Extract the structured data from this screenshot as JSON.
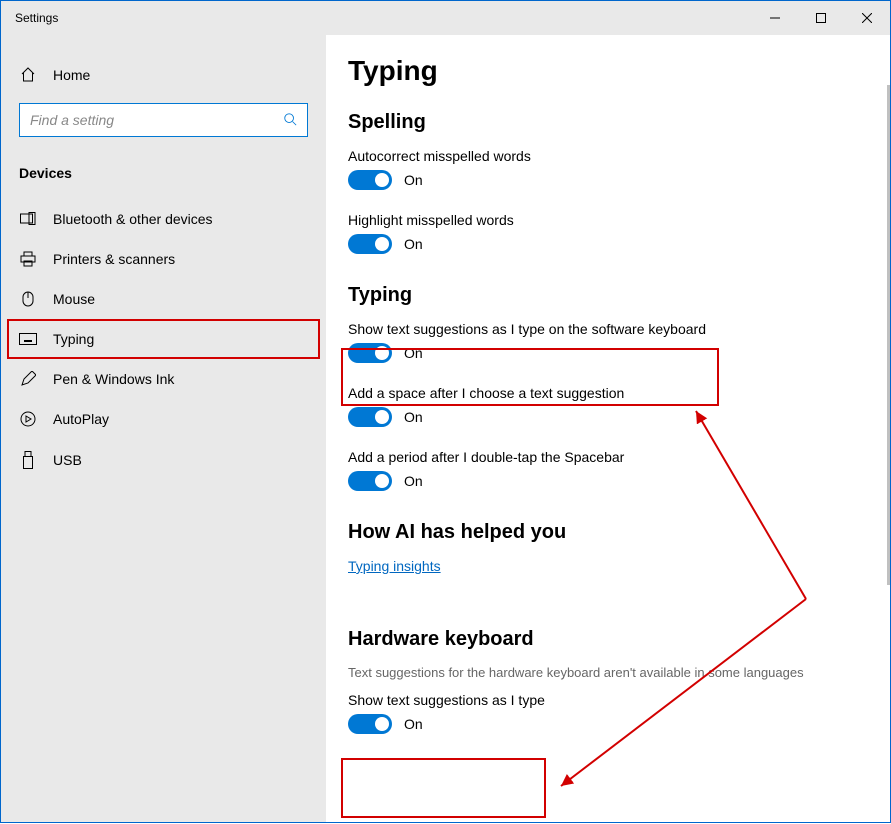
{
  "window": {
    "title": "Settings"
  },
  "sidebar": {
    "home_label": "Home",
    "search_placeholder": "Find a setting",
    "group": "Devices",
    "items": [
      {
        "label": "Bluetooth & other devices"
      },
      {
        "label": "Printers & scanners"
      },
      {
        "label": "Mouse"
      },
      {
        "label": "Typing"
      },
      {
        "label": "Pen & Windows Ink"
      },
      {
        "label": "AutoPlay"
      },
      {
        "label": "USB"
      }
    ]
  },
  "page": {
    "title": "Typing",
    "spelling": {
      "heading": "Spelling",
      "autocorrect": {
        "label": "Autocorrect misspelled words",
        "state": "On"
      },
      "highlight": {
        "label": "Highlight misspelled words",
        "state": "On"
      }
    },
    "typing": {
      "heading": "Typing",
      "suggestions": {
        "label": "Show text suggestions as I type on the software keyboard",
        "state": "On"
      },
      "space": {
        "label": "Add a space after I choose a text suggestion",
        "state": "On"
      },
      "period": {
        "label": "Add a period after I double-tap the Spacebar",
        "state": "On"
      }
    },
    "ai": {
      "heading": "How AI has helped you",
      "link": "Typing insights"
    },
    "hardware": {
      "heading": "Hardware keyboard",
      "subtext": "Text suggestions for the hardware keyboard aren't available in some languages",
      "suggestions": {
        "label": "Show text suggestions as I type",
        "state": "On"
      }
    }
  }
}
